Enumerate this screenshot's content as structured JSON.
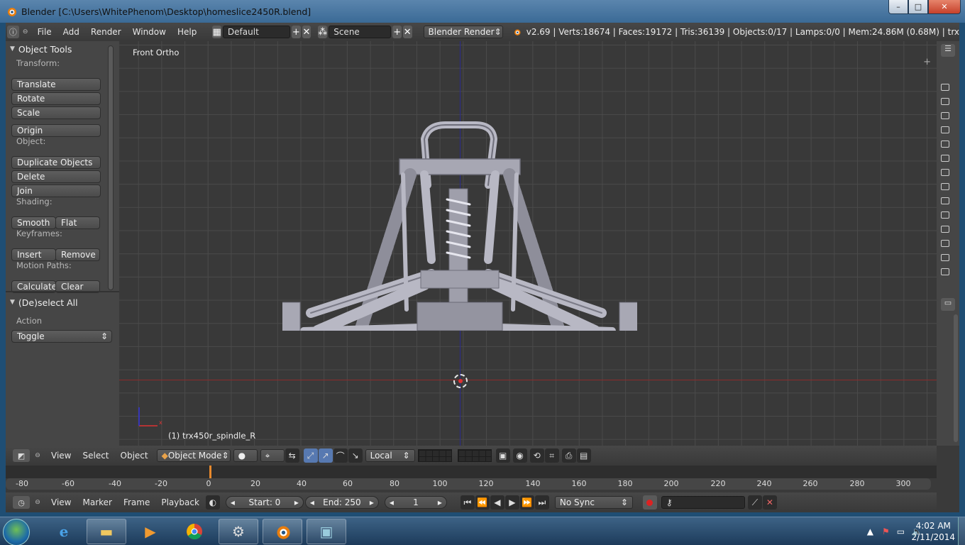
{
  "window": {
    "title": "Blender [C:\\Users\\WhitePhenom\\Desktop\\homeslice2450R.blend]",
    "minimize": "–",
    "maximize": "□",
    "close": "✕"
  },
  "info_header": {
    "menus": [
      "File",
      "Add",
      "Render",
      "Window",
      "Help"
    ],
    "layout": "Default",
    "scene": "Scene",
    "engine": "Blender Render",
    "stats": "v2.69 | Verts:18674 | Faces:19172 | Tris:36139 | Objects:0/17 | Lamps:0/0 | Mem:24.86M (0.68M) | trx"
  },
  "toolshelf": {
    "panel_title": "Object Tools",
    "transform_label": "Transform:",
    "translate": "Translate",
    "rotate": "Rotate",
    "scale": "Scale",
    "origin": "Origin",
    "object_label": "Object:",
    "duplicate": "Duplicate Objects",
    "delete": "Delete",
    "join": "Join",
    "shading_label": "Shading:",
    "smooth": "Smooth",
    "flat": "Flat",
    "keyframes_label": "Keyframes:",
    "insert": "Insert",
    "remove": "Remove",
    "motion_paths_label": "Motion Paths:",
    "calculate": "Calculate",
    "clear": "Clear",
    "operator_title": "(De)select All",
    "action_label": "Action",
    "action_value": "Toggle"
  },
  "viewport": {
    "view_name": "Front Ortho",
    "active_object": "(1) trx450r_spindle_R"
  },
  "view3d_header": {
    "menus": [
      "View",
      "Select",
      "Object"
    ],
    "mode": "Object Mode",
    "orientation": "Local"
  },
  "timeline": {
    "ticks": [
      "-80",
      "-60",
      "-40",
      "-20",
      "0",
      "20",
      "40",
      "60",
      "80",
      "100",
      "120",
      "140",
      "160",
      "180",
      "200",
      "220",
      "240",
      "260",
      "280",
      "300"
    ],
    "menus": [
      "View",
      "Marker",
      "Frame",
      "Playback"
    ],
    "start": "Start: 0",
    "end": "End: 250",
    "current": "1",
    "sync": "No Sync"
  },
  "taskbar": {
    "time": "4:02 AM",
    "date": "2/11/2014"
  },
  "colors": {
    "accent_active": "#5779b1",
    "x_axis": "#8b2b2b",
    "z_axis": "#2b2b8b",
    "frame_marker": "#e8892c"
  }
}
